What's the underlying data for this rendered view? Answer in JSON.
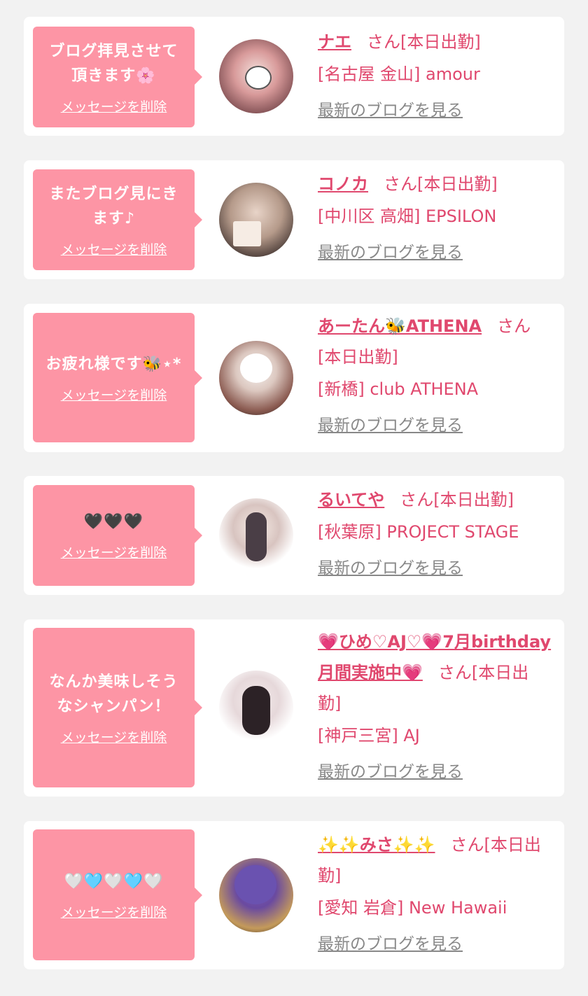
{
  "colors": {
    "bubble": "#fd95a5",
    "accent": "#e0486e",
    "link_gray": "#888888",
    "bg": "#f2f2f2"
  },
  "cards": [
    {
      "message": "ブログ拝見させて\n頂きます🌸",
      "delete_label": "メッセージを削除",
      "name": "ナエ",
      "suffix": "さん[本日出勤]",
      "shop": "[名古屋 金山] amour",
      "blog_link": "最新のブログを見る"
    },
    {
      "message": "またブログ見にき\nます♪",
      "delete_label": "メッセージを削除",
      "name": "コノカ",
      "suffix": "さん[本日出勤]",
      "shop": "[中川区 高畑] EPSILON",
      "blog_link": "最新のブログを見る"
    },
    {
      "message": "お疲れ様です🐝⋆*",
      "delete_label": "メッセージを削除",
      "name": "あーたん🐝ATHENA",
      "suffix": "さん[本日出勤]",
      "shop": "[新橋] club ATHENA",
      "blog_link": "最新のブログを見る"
    },
    {
      "message": "🖤🖤🖤",
      "delete_label": "メッセージを削除",
      "name": "るいてや",
      "suffix": "さん[本日出勤]",
      "shop": "[秋葉原] PROJECT STAGE",
      "blog_link": "最新のブログを見る"
    },
    {
      "message": "なんか美味しそう\nなシャンパン！",
      "delete_label": "メッセージを削除",
      "name": "💗ひめ♡AJ♡💗7月birthday月間実施中💗",
      "suffix": "さん[本日出勤]",
      "shop": "[神戸三宮] AJ",
      "blog_link": "最新のブログを見る"
    },
    {
      "message": "🤍🩵🤍🩵🤍",
      "delete_label": "メッセージを削除",
      "name": "✨✨みさ✨✨",
      "suffix": "さん[本日出勤]",
      "shop": "[愛知 岩倉] New Hawaii",
      "blog_link": "最新のブログを見る"
    }
  ]
}
